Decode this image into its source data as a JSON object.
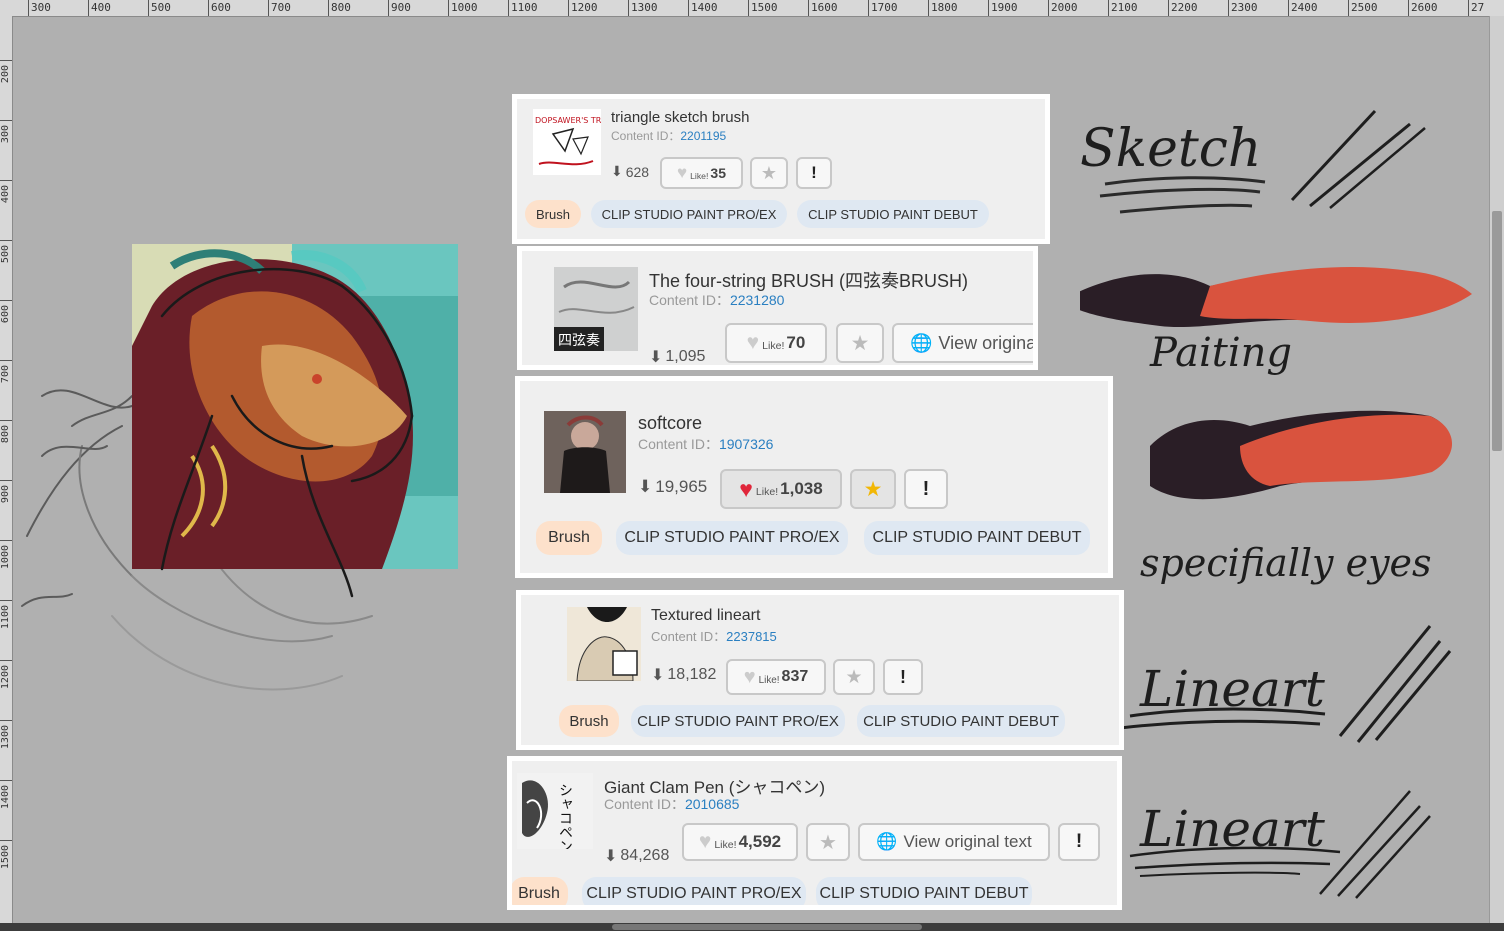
{
  "ruler": {
    "top_ticks": [
      "300",
      "400",
      "500",
      "600",
      "700",
      "800",
      "900",
      "1000",
      "1100",
      "1200",
      "1300",
      "1400",
      "1500",
      "1600",
      "1700",
      "1800",
      "1900",
      "2000",
      "2100",
      "2200",
      "2300",
      "2400",
      "2500",
      "2600",
      "27"
    ],
    "left_ticks": [
      "200",
      "300",
      "400",
      "500",
      "600",
      "700",
      "800",
      "900",
      "1000",
      "1100",
      "1200",
      "1300",
      "1400",
      "1500"
    ]
  },
  "notes": {
    "sketch": "Sketch",
    "painting": "Paiting",
    "eyes": "specifially eyes",
    "lineart1": "Lineart",
    "lineart2": "Lineart"
  },
  "common": {
    "like_word": "Like!",
    "report_label": "!",
    "view_original": "View original text",
    "content_id_label": "Content ID："
  },
  "colors": {
    "brush_tag_bg": "#fde1cb",
    "platform_tag_bg": "#dfe8f2",
    "content_id_link": "#2a7fc1",
    "heart_liked": "#e0263a",
    "star_fav": "#f2b705",
    "paint_red": "#d9533e",
    "paint_dark": "#2a1e26"
  },
  "cards": [
    {
      "title": "triangle sketch brush",
      "content_id": "2201195",
      "downloads": "628",
      "likes": "35",
      "liked": false,
      "favorited": false,
      "thumbnail_text": "DOPSAWER'S TRIANGLE BRUSH",
      "tags": [
        "Brush",
        "CLIP STUDIO PAINT PRO/EX",
        "CLIP STUDIO PAINT DEBUT"
      ]
    },
    {
      "title": "The four-string BRUSH (四弦奏BRUSH)",
      "content_id": "2231280",
      "downloads": "1,095",
      "likes": "70",
      "liked": false,
      "favorited": false,
      "thumbnail_text": "四弦奏",
      "view_original_partial": "View origina",
      "tags": []
    },
    {
      "title": "softcore",
      "content_id": "1907326",
      "downloads": "19,965",
      "likes": "1,038",
      "liked": true,
      "favorited": true,
      "tags": [
        "Brush",
        "CLIP STUDIO PAINT PRO/EX",
        "CLIP STUDIO PAINT DEBUT"
      ]
    },
    {
      "title": "Textured lineart",
      "content_id": "2237815",
      "downloads": "18,182",
      "likes": "837",
      "liked": false,
      "favorited": false,
      "tags": [
        "Brush",
        "CLIP STUDIO PAINT PRO/EX",
        "CLIP STUDIO PAINT DEBUT"
      ]
    },
    {
      "title": "Giant Clam Pen (シャコペン)",
      "content_id": "2010685",
      "downloads": "84,268",
      "likes": "4,592",
      "liked": false,
      "favorited": false,
      "thumbnail_text": "シャコペン",
      "tags": [
        "Brush",
        "CLIP STUDIO PAINT PRO/EX",
        "CLIP STUDIO PAINT DEBUT"
      ]
    }
  ]
}
